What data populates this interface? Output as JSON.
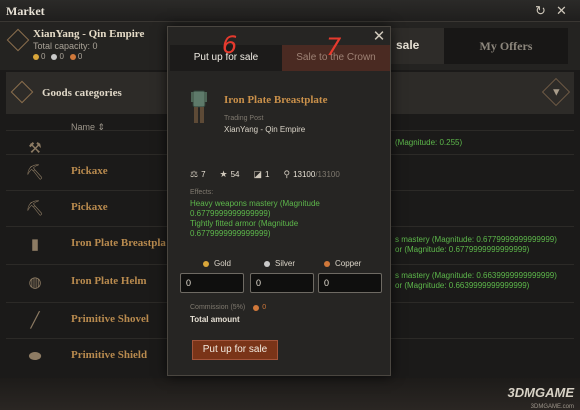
{
  "window": {
    "title": "Market",
    "buttons": [
      "↻",
      "✕"
    ]
  },
  "header": {
    "trading_post": "XianYang - Qin Empire",
    "capacity": "Total capacity: 0",
    "coins": [
      "0",
      "0",
      "0"
    ]
  },
  "tabs": {
    "sale_partial": "sale",
    "my_offers": "My Offers"
  },
  "categories": {
    "label": "Goods categories"
  },
  "list": {
    "name_header": "Name ⇕",
    "items": [
      {
        "name": "",
        "icon": "hammer-icon",
        "extra": "(Magnitude: 0.255)"
      },
      {
        "name": "Pickaxe",
        "icon": "pickaxe-icon",
        "extra": ""
      },
      {
        "name": "Pickaxe",
        "icon": "pickaxe-icon",
        "extra": ""
      },
      {
        "name": "Iron Plate Breastpla",
        "icon": "breastplate-icon",
        "extra": "s mastery (Magnitude: 0.6779999999999999)",
        "extra2": "or (Magnitude: 0.6779999999999999)"
      },
      {
        "name": "Iron Plate Helm",
        "icon": "helm-icon",
        "extra": "s mastery (Magnitude: 0.6639999999999999)",
        "extra2": "or (Magnitude: 0.6639999999999999)"
      },
      {
        "name": "Primitive Shovel",
        "icon": "shovel-icon",
        "extra": ""
      },
      {
        "name": "Primitive Shield",
        "icon": "shield-icon",
        "extra": ""
      }
    ]
  },
  "modal": {
    "tab_sale": "Put up for sale",
    "tab_crown": "Sale to the Crown",
    "annotation_6": "6",
    "annotation_7": "7",
    "close": "✕",
    "item_name": "Iron Plate Breastplate",
    "trading_post_label": "Trading Post",
    "trading_post_value": "XianYang - Qin Empire",
    "stats": {
      "weight": "7",
      "rating": "54",
      "count": "1",
      "durability": "13100",
      "durability_max": "/13100"
    },
    "effects_label": "Effects:",
    "effects": [
      "Heavy weapons mastery (Magnitude",
      "0.6779999999999999)",
      "Tightly fitted armor (Magnitude",
      "0.6779999999999999)"
    ],
    "currency": {
      "gold_label": "Gold",
      "silver_label": "Silver",
      "copper_label": "Copper",
      "gold_value": "0",
      "silver_value": "0",
      "copper_value": "0",
      "gold_color": "#d9a63a",
      "silver_color": "#c9c9c9",
      "copper_color": "#d0783a"
    },
    "commission_label": "Commission (5%)",
    "commission_value": "0",
    "total_label": "Total amount",
    "submit_label": "Put up for sale"
  },
  "watermark": {
    "text": "3DMGAME",
    "sub": "3DMGAME.com"
  }
}
